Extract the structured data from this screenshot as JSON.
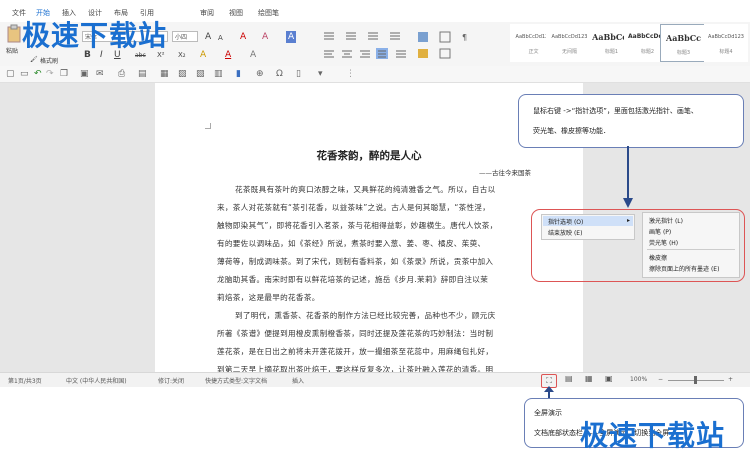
{
  "menu": [
    "文件",
    "开始",
    "插入",
    "设计",
    "布局",
    "引用",
    "审阅",
    "视图",
    "绘图笔"
  ],
  "ribbon": {
    "paste_label": "粘贴",
    "format_painter_label": "格式刷",
    "font_name": "宋体",
    "font_size": "小四",
    "btn_grow": "A",
    "btn_shrink": "A",
    "btn_clear": "A",
    "btn_bold": "B",
    "btn_italic": "I",
    "btn_underline": "U",
    "btn_strike": "abc",
    "btn_sup": "X²",
    "btn_sub": "X₂",
    "btn_font_color": "A",
    "btn_highlight": "A",
    "styles": [
      {
        "sample": "AaBbCcDd123",
        "name": "正文"
      },
      {
        "sample": "AaBbCcDd123",
        "name": "无间隔"
      },
      {
        "sample": "AaBbCcI",
        "name": "标题1"
      },
      {
        "sample": "AaBbCcDd1",
        "name": "标题2"
      },
      {
        "sample": "AaBbCc",
        "name": "标题3"
      },
      {
        "sample": "AaBbCcDd123",
        "name": "标题4"
      }
    ]
  },
  "document": {
    "title": "花香茶韵，醉的是人心",
    "author": "——古往今来国茶",
    "lines": [
      "花茶既具有茶叶的爽口浓醇之味，又具鲜花的纯清雅香之气。所以，自古以",
      "来，茶人对花茶就有“茶引花香，以益茶味”之说。古人是何其聪慧，“茶性淫，",
      "触物即染其气”，即将花香引入茗茶，茶与花相得益彰，妙趣横生。唐代人饮茶，",
      "有的要佐以调味品，如《茶经》所说，煮茶时要入葱、姜、枣、橘皮、茱萸、",
      "薄荷等，制成调味茶。到了宋代，则制有香料茶，如《茶录》所说，贡茶中加入",
      "龙脑助其香。南宋时即有以鲜花培茶的记述，施岳《步月.茉莉》辞即自注以茉",
      "莉焙茶，这是最早的花香茶。",
      "到了明代，熏香茶、花香茶的制作方法已经比较完善，品种也不少，顾元庆",
      "所著《茶谱》便提到用橙皮熏制橙香茶，同时还提及莲花茶的巧妙制法：当时制",
      "莲花茶，是在日出之前将未开莲花拨开，放一撮细茶至花蕊中，用麻绳包扎好，",
      "到第二天早上摘花取出茶叶焙干，要这样反复多次，让茶叶融入莲花的清香。明"
    ]
  },
  "callout_top": {
    "line1": "鼠标右键 ->“指针选项”，里面包括激光指针、画笔、",
    "line2": "荧光笔、橡皮擦等功能．"
  },
  "context_menu": {
    "left_items": [
      {
        "label": "指针选项",
        "key": "(O)"
      },
      {
        "label": "结束放映",
        "key": "(E)"
      }
    ],
    "sub_items": [
      {
        "label": "激光指针",
        "key": "(L)"
      },
      {
        "label": "画笔",
        "key": "(P)"
      },
      {
        "label": "荧光笔",
        "key": "(H)"
      },
      {
        "label": "橡皮擦",
        "key": ""
      },
      {
        "label": "擦除页面上的所有墨迹",
        "key": "(E)"
      }
    ]
  },
  "statusbar": {
    "page": "第1页/共3页",
    "language": "中文 (中华人民共和国)",
    "revision": "修订:关闭",
    "quick_mode": "快捷方式类型:文字文档",
    "insert": "插入",
    "zoom": "100%"
  },
  "callout_bottom": {
    "line1": "全屏演示",
    "line2": "文档底部状态栏 ——全屏演示，切换到全屏"
  },
  "watermark": "极速下载站",
  "colors": {
    "accent": "#1a6fd0",
    "callout_border": "#6a7fb6",
    "context_border": "#dd5555",
    "arrow": "#2b4a8a"
  }
}
